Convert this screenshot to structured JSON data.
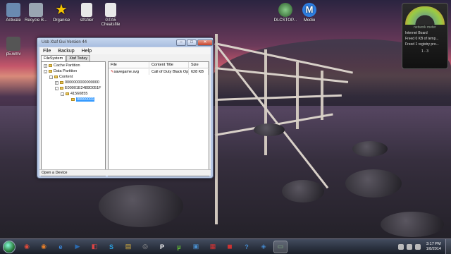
{
  "desktop": {
    "icons": [
      {
        "label": "Activate",
        "icon": "computer-icon",
        "color": "#6a8ab0"
      },
      {
        "label": "Recycle B...",
        "icon": "recycle-bin-icon",
        "color": "#9aa6b2"
      },
      {
        "label": "Organise",
        "icon": "star-icon",
        "color": "#f5c400"
      },
      {
        "label": "stfsfiler",
        "icon": "file-icon",
        "color": "#e8e8e8"
      },
      {
        "label": "GTA5 Cheatsfile",
        "icon": "file-icon",
        "color": "#e8e8e8"
      },
      {
        "label": "p5.wmv",
        "icon": "video-icon",
        "color": "#555"
      },
      {
        "label": "DLCSTOP...",
        "icon": "xbox-icon",
        "color": "#3a7a3a"
      },
      {
        "label": "Modio",
        "icon": "modio-icon",
        "color": "#2d7de0"
      }
    ]
  },
  "gadget": {
    "title": "network meter",
    "rows": [
      "Internet Board",
      "Freed 0 KB of temp...",
      "Freed 1 registry pro..."
    ],
    "pager": "1 - 3"
  },
  "window": {
    "title": "Usb Xtaf Gui Version 44",
    "controls": {
      "minimize": "–",
      "maximize": "□",
      "close": "✕"
    },
    "menu": [
      "File",
      "Backup",
      "Help"
    ],
    "tabs": [
      "FileSystem",
      "Xtaf Today"
    ],
    "tree": [
      {
        "label": "Cache Partition",
        "level": 0,
        "expander": "+"
      },
      {
        "label": "Data Partition",
        "level": 0,
        "expander": "-"
      },
      {
        "label": "Content",
        "level": 1,
        "expander": "-"
      },
      {
        "label": "0000000000000000",
        "level": 2,
        "expander": "+"
      },
      {
        "label": "E00001E2489D051F",
        "level": 2,
        "expander": "-"
      },
      {
        "label": "41560855",
        "level": 3,
        "expander": "-"
      },
      {
        "label": "00000001",
        "level": 4,
        "expander": "",
        "selected": true
      }
    ],
    "list": {
      "columns": [
        "File",
        "Content Title",
        "Size"
      ],
      "rows": [
        {
          "file": "savegame.svg",
          "title": "Call of Duty Black Ops",
          "size": "628 KB"
        }
      ]
    },
    "status": "Open a Device"
  },
  "taskbar": {
    "apps": [
      {
        "icon": "chrome-icon",
        "glyph": "◉",
        "color": "#e04a3a"
      },
      {
        "icon": "firefox-icon",
        "glyph": "◉",
        "color": "#e8802a"
      },
      {
        "icon": "ie-icon",
        "glyph": "e",
        "color": "#3a8ae0"
      },
      {
        "icon": "media-player-icon",
        "glyph": "▶",
        "color": "#2a6ab0"
      },
      {
        "icon": "paint-icon",
        "glyph": "◧",
        "color": "#d44"
      },
      {
        "icon": "skype-icon",
        "glyph": "S",
        "color": "#2aa0e0"
      },
      {
        "icon": "explorer-icon",
        "glyph": "▤",
        "color": "#d8b040"
      },
      {
        "icon": "app-icon",
        "glyph": "◎",
        "color": "#999"
      },
      {
        "icon": "pandora-icon",
        "glyph": "P",
        "color": "#fff"
      },
      {
        "icon": "utorrent-icon",
        "glyph": "µ",
        "color": "#6c3"
      },
      {
        "icon": "folder-icon",
        "glyph": "▣",
        "color": "#4a90d0"
      },
      {
        "icon": "app-icon",
        "glyph": "▦",
        "color": "#d33"
      },
      {
        "icon": "app-icon",
        "glyph": "◼",
        "color": "#c33"
      },
      {
        "icon": "help-icon",
        "glyph": "?",
        "color": "#48c"
      },
      {
        "icon": "app-icon",
        "glyph": "◈",
        "color": "#48c"
      },
      {
        "icon": "xtaf-icon",
        "glyph": "▭",
        "color": "#8b8",
        "active": true
      }
    ],
    "clock": {
      "time": "3:17 PM",
      "date": "1/8/2014"
    }
  }
}
